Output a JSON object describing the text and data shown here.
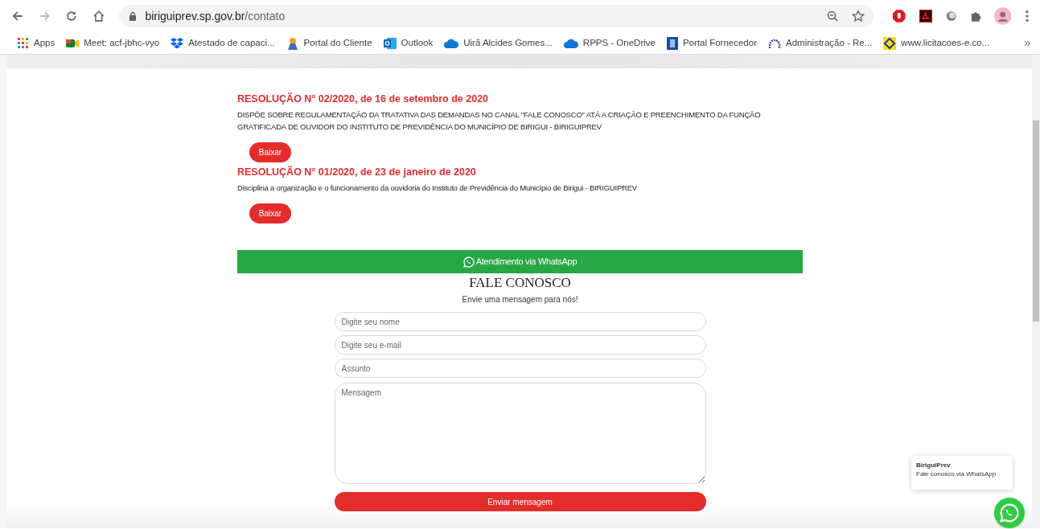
{
  "browser": {
    "address": {
      "host": "biriguiprev.sp.gov.br",
      "path": "/contato"
    },
    "bookmarks": [
      {
        "label": "Apps"
      },
      {
        "label": "Meet: acf-jbhc-vyo"
      },
      {
        "label": "Atestado de capaci..."
      },
      {
        "label": "Portal do Cliente"
      },
      {
        "label": "Outlook"
      },
      {
        "label": "Uirã Alcides Gomes..."
      },
      {
        "label": "RPPS - OneDrive"
      },
      {
        "label": "Portal Fornecedor"
      },
      {
        "label": "Administração - Re..."
      },
      {
        "label": "www.licitacoes-e.co..."
      }
    ],
    "overflow": "»"
  },
  "resolutions": [
    {
      "title": "RESOLUÇÃO N° 02/2020, de 16 de setembro de 2020",
      "description": "DISPÕE SOBRE REGULAMENTAÇÃO DA TRATATIVA DAS DEMANDAS NO CANAL \"FALE CONOSCO\" ATÁ A CRIAÇÃO E PREENCHIMENTO DA FUNÇÃO GRATIFICADA DE OUVIDOR DO INSTITUTO DE PREVIDÊNCIA DO MUNICÍPIO DE BIRIGUI - BIRIGUIPREV",
      "button": "Baixar"
    },
    {
      "title": "RESOLUÇÃO N° 01/2020, de 23 de janeiro de 2020",
      "description": "Disciplina a organização e o funcionamento da ouvidoria do Instituto de Previdência do Município de Birigui - BIRIGUIPREV",
      "button": "Baixar"
    }
  ],
  "whatsapp_bar": {
    "label": "Atendimento via WhatsApp"
  },
  "contact": {
    "heading": "FALE CONOSCO",
    "subtitle": "Envie uma mensagem para nós!",
    "fields": [
      {
        "kind": "input",
        "placeholder": "Digite seu nome"
      },
      {
        "kind": "input",
        "placeholder": "Digite seu e-mail"
      },
      {
        "kind": "input",
        "placeholder": "Assunto"
      },
      {
        "kind": "textarea",
        "placeholder": "Mensagem"
      }
    ],
    "submit": "Enviar mensagem"
  },
  "chat_popup": {
    "title": "BiriguiPrev",
    "text": "Fale conosco via WhatsApp"
  }
}
